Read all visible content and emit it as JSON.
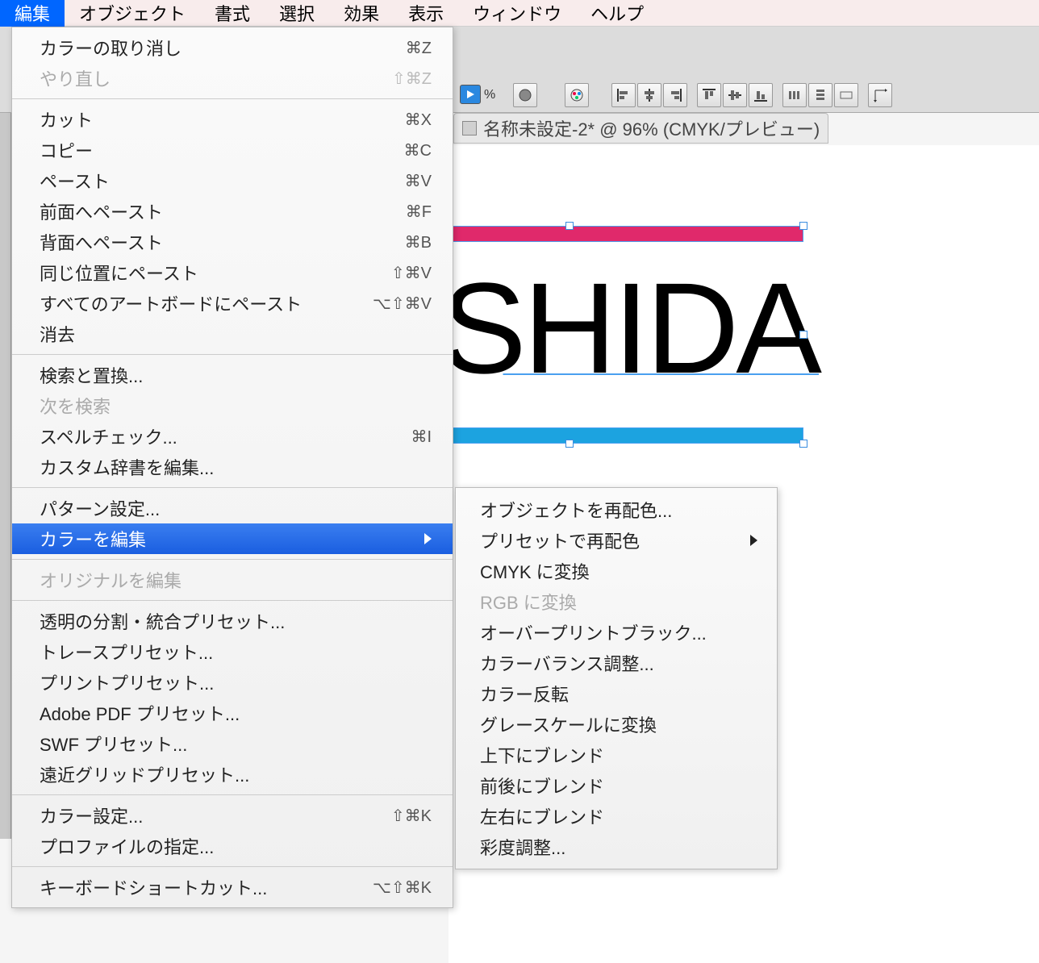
{
  "menubar": {
    "items": [
      "編集",
      "オブジェクト",
      "書式",
      "選択",
      "効果",
      "表示",
      "ウィンドウ",
      "ヘルプ"
    ]
  },
  "toolbar": {
    "percent": "%"
  },
  "document": {
    "title": "名称未設定-2* @ 96% (CMYK/プレビュー)",
    "artwork_text": "SHIDA"
  },
  "edit_menu": {
    "groups": [
      [
        {
          "label": "カラーの取り消し",
          "shortcut": "⌘Z",
          "disabled": false
        },
        {
          "label": "やり直し",
          "shortcut": "⇧⌘Z",
          "disabled": true
        }
      ],
      [
        {
          "label": "カット",
          "shortcut": "⌘X"
        },
        {
          "label": "コピー",
          "shortcut": "⌘C"
        },
        {
          "label": "ペースト",
          "shortcut": "⌘V"
        },
        {
          "label": "前面へペースト",
          "shortcut": "⌘F"
        },
        {
          "label": "背面へペースト",
          "shortcut": "⌘B"
        },
        {
          "label": "同じ位置にペースト",
          "shortcut": "⇧⌘V"
        },
        {
          "label": "すべてのアートボードにペースト",
          "shortcut": "⌥⇧⌘V"
        },
        {
          "label": "消去",
          "shortcut": ""
        }
      ],
      [
        {
          "label": "検索と置換...",
          "shortcut": ""
        },
        {
          "label": "次を検索",
          "shortcut": "",
          "disabled": true
        },
        {
          "label": "スペルチェック...",
          "shortcut": "⌘I"
        },
        {
          "label": "カスタム辞書を編集...",
          "shortcut": ""
        }
      ],
      [
        {
          "label": "パターン設定...",
          "shortcut": ""
        },
        {
          "label": "カラーを編集",
          "shortcut": "",
          "highlighted": true,
          "submenu": true
        }
      ],
      [
        {
          "label": "オリジナルを編集",
          "shortcut": "",
          "disabled": true
        }
      ],
      [
        {
          "label": "透明の分割・統合プリセット...",
          "shortcut": ""
        },
        {
          "label": "トレースプリセット...",
          "shortcut": ""
        },
        {
          "label": "プリントプリセット...",
          "shortcut": ""
        },
        {
          "label": "Adobe PDF プリセット...",
          "shortcut": ""
        },
        {
          "label": "SWF プリセット...",
          "shortcut": ""
        },
        {
          "label": "遠近グリッドプリセット...",
          "shortcut": ""
        }
      ],
      [
        {
          "label": "カラー設定...",
          "shortcut": "⇧⌘K"
        },
        {
          "label": "プロファイルの指定...",
          "shortcut": ""
        }
      ],
      [
        {
          "label": "キーボードショートカット...",
          "shortcut": "⌥⇧⌘K"
        }
      ]
    ]
  },
  "color_submenu": {
    "items": [
      {
        "label": "オブジェクトを再配色...",
        "submenu": false
      },
      {
        "label": "プリセットで再配色",
        "submenu": true
      },
      {
        "label": "CMYK に変換"
      },
      {
        "label": "RGB に変換",
        "disabled": true
      },
      {
        "label": "オーバープリントブラック..."
      },
      {
        "label": "カラーバランス調整..."
      },
      {
        "label": "カラー反転"
      },
      {
        "label": "グレースケールに変換"
      },
      {
        "label": "上下にブレンド"
      },
      {
        "label": "前後にブレンド"
      },
      {
        "label": "左右にブレンド"
      },
      {
        "label": "彩度調整..."
      }
    ]
  }
}
